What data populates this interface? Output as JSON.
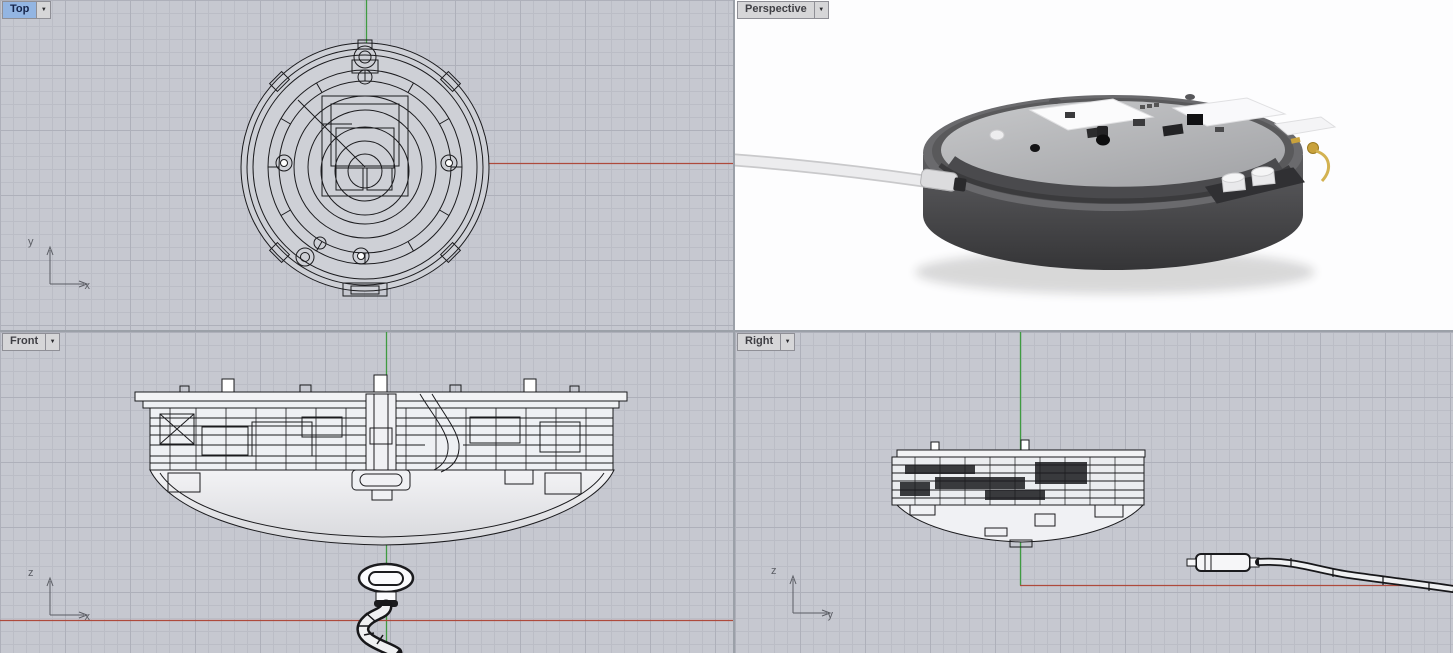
{
  "icons": {
    "dropdown": "▼"
  },
  "colors": {
    "grid_bg": "#c6c8d0",
    "grid_minor": "#bbbdc6",
    "grid_major": "#aeb0ba",
    "axis_red": "#ae4a3c",
    "axis_green": "#3f9b41",
    "axis_ind": "#5b5d64",
    "wire": "#1b1b1e",
    "active_tab_bg": "#93b5e2",
    "active_tab_text": "#15244a",
    "tab_bg": "#d6d6d8",
    "tab_text": "#3f3f44",
    "tab_border": "#8f8f96",
    "gap_bg": "#e9e9eb",
    "perspective_bg": "#fdfdfe"
  },
  "viewports": {
    "top": {
      "label": "Top",
      "active": true,
      "axis_h": "x",
      "axis_v": "y"
    },
    "perspective": {
      "label": "Perspective",
      "active": false
    },
    "front": {
      "label": "Front",
      "active": false,
      "axis_h": "x",
      "axis_v": "z"
    },
    "right": {
      "label": "Right",
      "active": false,
      "axis_h": "y",
      "axis_v": "z"
    }
  }
}
